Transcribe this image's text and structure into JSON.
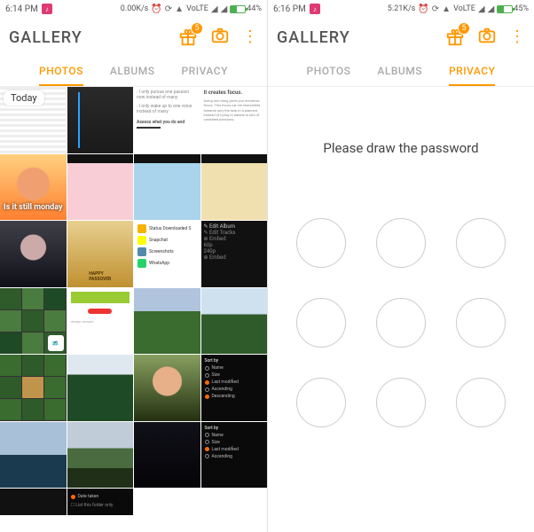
{
  "left": {
    "status": {
      "time": "6:14 PM",
      "net_speed": "0.00K/s",
      "volte": "VoLTE",
      "battery_pct": "44%",
      "battery_fill": 44
    },
    "appbar": {
      "title": "GALLERY",
      "badge": "5"
    },
    "tabs": {
      "photos": "PHOTOS",
      "albums": "ALBUMS",
      "privacy": "PRIVACY",
      "active": "photos"
    },
    "date_overlay": "Today",
    "thumbs": {
      "t2_line1": "Assess what you do and",
      "t3_title": "It creates focus.",
      "t4_overlay": "Is it still monday",
      "apps": [
        "Status Downloaded S",
        "Snapchat",
        "Screenshots",
        "WhatsApp"
      ]
    }
  },
  "right": {
    "status": {
      "time": "6:16 PM",
      "net_speed": "5.21K/s",
      "volte": "VoLTE",
      "battery_pct": "45%",
      "battery_fill": 45
    },
    "appbar": {
      "title": "GALLERY",
      "badge": "5"
    },
    "tabs": {
      "photos": "PHOTOS",
      "albums": "ALBUMS",
      "privacy": "PRIVACY",
      "active": "privacy"
    },
    "privacy_msg": "Please draw the password"
  },
  "icons": {
    "gift": "gift-icon",
    "camera": "camera-icon",
    "overflow": "overflow-icon",
    "alarm": "alarm-icon",
    "wifi": "wifi-icon",
    "signal": "signal-icon"
  }
}
